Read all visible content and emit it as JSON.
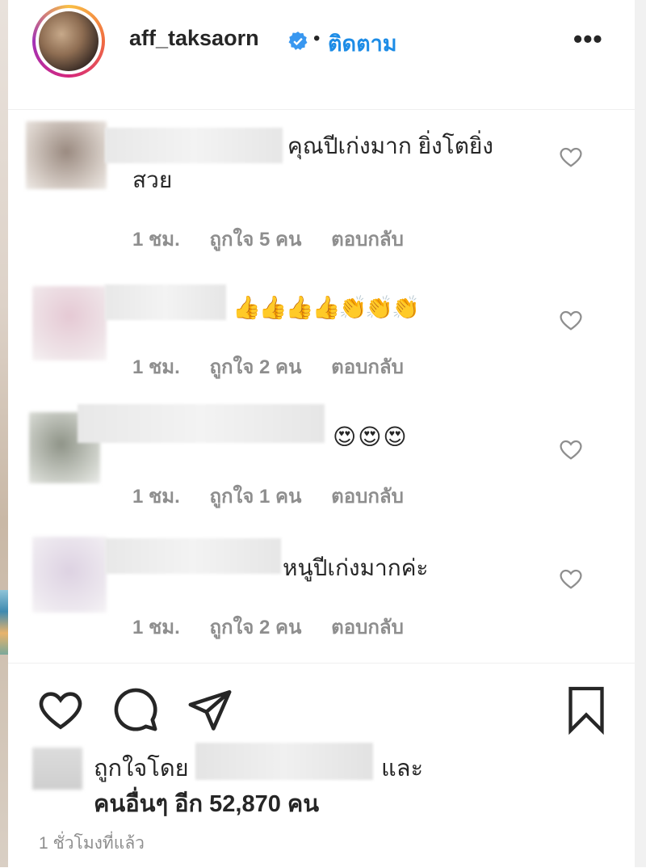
{
  "post": {
    "username": "aff_taksaorn",
    "separator": "•",
    "follow_label": "ติดตาม",
    "more_label": "•••"
  },
  "comments": [
    {
      "text_line1": "คุณปีเก่งมาก ยิ่งโตยิ่ง",
      "text_line2": "สวย",
      "time": "1 ชม.",
      "likes": "ถูกใจ 5 คน",
      "reply": "ตอบกลับ"
    },
    {
      "text_line1": "👍👍👍👍👏👏👏",
      "text_line2": "",
      "time": "1 ชม.",
      "likes": "ถูกใจ 2 คน",
      "reply": "ตอบกลับ"
    },
    {
      "text_line1": "😍😍😍",
      "text_line2": "",
      "time": "1 ชม.",
      "likes": "ถูกใจ 1 คน",
      "reply": "ตอบกลับ"
    },
    {
      "text_line1": "หนูปีเก่งมากค่ะ",
      "text_line2": "",
      "time": "1 ชม.",
      "likes": "ถูกใจ 2 คน",
      "reply": "ตอบกลับ"
    }
  ],
  "likes_summary": {
    "liked_by_label": "ถูกใจโดย",
    "and_label": "และ",
    "others_label": "คนอื่นๆ อีก 52,870 คน"
  },
  "timestamp": "1 ชั่วโมงที่แล้ว",
  "colors": {
    "accent": "#1d8ce6",
    "text": "#262626",
    "muted": "#8e8e8e"
  }
}
